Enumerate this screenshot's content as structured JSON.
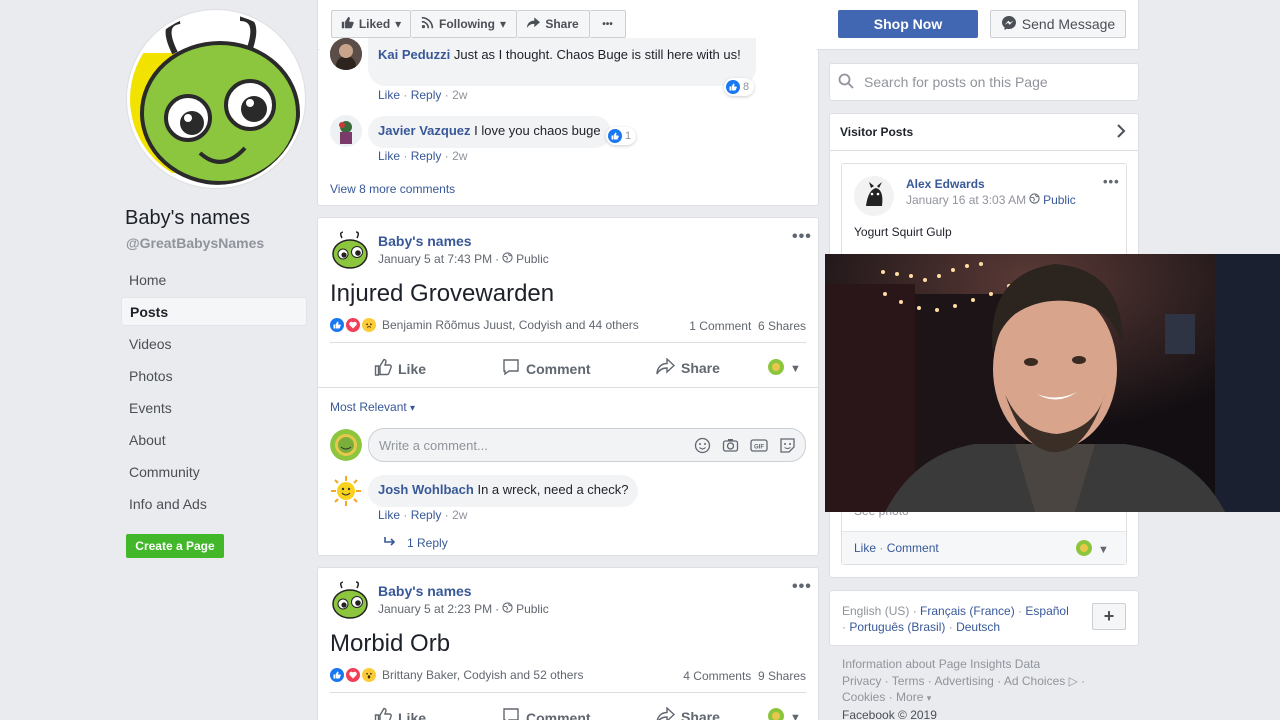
{
  "page": {
    "name": "Baby's names",
    "handle": "@GreatBabysNames"
  },
  "nav": {
    "items": [
      "Home",
      "Posts",
      "Videos",
      "Photos",
      "Events",
      "About",
      "Community",
      "Info and Ads"
    ],
    "active": "Posts",
    "create_page": "Create a Page"
  },
  "topbar": {
    "liked": "Liked",
    "following": "Following",
    "share": "Share",
    "more": "•••",
    "shop_now": "Shop Now",
    "send_message": "Send Message"
  },
  "comments_top": [
    {
      "name": "Kai Peduzzi",
      "text": "Just as I thought. Chaos Buge is still here with us!",
      "like": "Like",
      "reply": "Reply",
      "age": "2w",
      "reactions": "8"
    },
    {
      "name": "Javier Vazquez",
      "text": "I love you chaos buge",
      "like": "Like",
      "reply": "Reply",
      "age": "2w",
      "reactions": "1"
    }
  ],
  "view_more": "View 8 more comments",
  "post1": {
    "author": "Baby's names",
    "date": "January 5 at 7:43 PM",
    "privacy": "Public",
    "title": "Injured Grovewarden",
    "reactors": "Benjamin Rõõmus Juust, Codyish and 44 others",
    "comments": "1 Comment",
    "shares": "6 Shares",
    "actions": {
      "like": "Like",
      "comment": "Comment",
      "share": "Share"
    },
    "sort": "Most Relevant",
    "input_placeholder": "Write a comment...",
    "comment": {
      "name": "Josh Wohlbach",
      "text": "In a wreck, need a check?",
      "like": "Like",
      "reply": "Reply",
      "age": "2w",
      "replies": "1 Reply"
    }
  },
  "post2": {
    "author": "Baby's names",
    "date": "January 5 at 2:23 PM",
    "privacy": "Public",
    "title": "Morbid Orb",
    "reactors": "Brittany Baker, Codyish and 52 others",
    "comments": "4 Comments",
    "shares": "9 Shares",
    "actions": {
      "like": "Like",
      "comment": "Comment",
      "share": "Share"
    }
  },
  "sidebar": {
    "search_placeholder": "Search for posts on this Page",
    "visitor_posts": "Visitor Posts",
    "visitor_post": {
      "author": "Alex Edwards",
      "date": "January 16 at 3:03 AM",
      "privacy": "Public",
      "text": "Yogurt Squirt Gulp",
      "partial": "See photo",
      "like": "Like",
      "comment": "Comment"
    },
    "languages": {
      "current": "English (US)",
      "others": [
        "Français (France)",
        "Español",
        "Português (Brasil)",
        "Deutsch"
      ],
      "add": "+"
    },
    "footer": {
      "line1": "Information about Page Insights Data",
      "links": [
        "Privacy",
        "Terms",
        "Advertising",
        "Ad Choices",
        "Cookies",
        "More"
      ],
      "copyright": "Facebook © 2019"
    }
  },
  "colors": {
    "brand": "#4267b2",
    "link": "#385898",
    "background": "#e9ebee",
    "green": "#42b72a"
  }
}
